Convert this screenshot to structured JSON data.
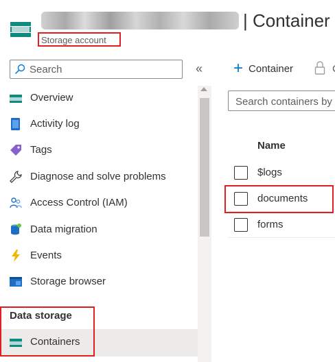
{
  "header": {
    "title": "| Container",
    "subtitle": "Storage account"
  },
  "sidebar": {
    "search_placeholder": "Search",
    "collapse_glyph": "«",
    "items": [
      {
        "label": "Overview",
        "icon": "overview-icon"
      },
      {
        "label": "Activity log",
        "icon": "activity-log-icon"
      },
      {
        "label": "Tags",
        "icon": "tag-icon"
      },
      {
        "label": "Diagnose and solve problems",
        "icon": "wrench-icon"
      },
      {
        "label": "Access Control (IAM)",
        "icon": "people-icon"
      },
      {
        "label": "Data migration",
        "icon": "data-migration-icon"
      },
      {
        "label": "Events",
        "icon": "lightning-icon"
      },
      {
        "label": "Storage browser",
        "icon": "storage-browser-icon"
      }
    ],
    "sections": [
      {
        "title": "Data storage",
        "items": [
          {
            "label": "Containers",
            "icon": "containers-icon",
            "selected": true
          }
        ]
      }
    ]
  },
  "toolbar": {
    "add_label": "Container",
    "cut_label": "C"
  },
  "filter": {
    "placeholder": "Search containers by"
  },
  "table": {
    "column_name": "Name",
    "rows": [
      "$logs",
      "documents",
      "forms"
    ]
  },
  "colors": {
    "accent": "#0078d4",
    "highlight": "#e02020",
    "teal": "#0f8a7f"
  }
}
